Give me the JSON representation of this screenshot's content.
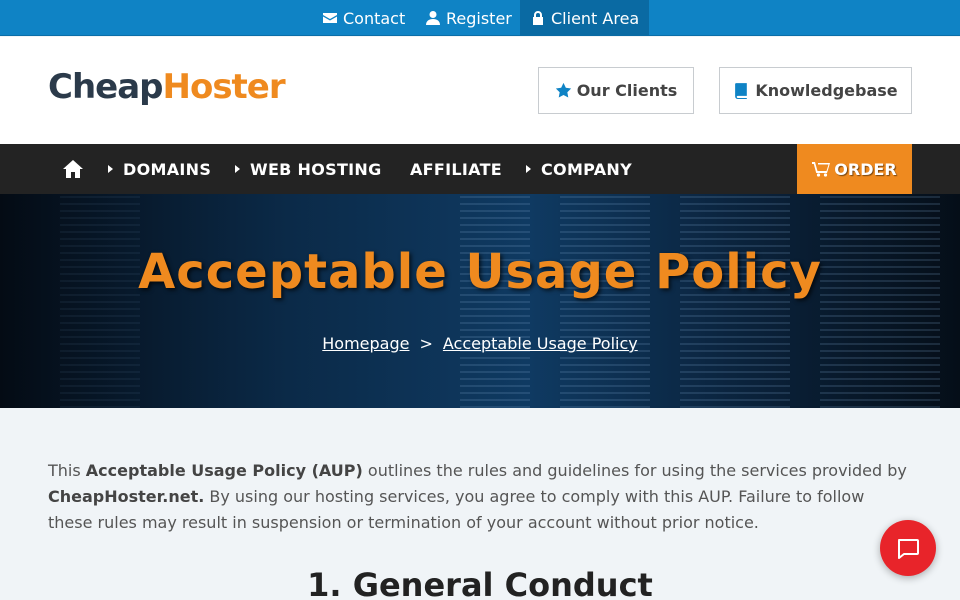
{
  "topbar": {
    "contact": "Contact",
    "register": "Register",
    "client_area": "Client Area"
  },
  "header": {
    "logo_part1": "Cheap",
    "logo_part2": "Hoster",
    "our_clients": "Our Clients",
    "knowledgebase": "Knowledgebase"
  },
  "nav": {
    "items": [
      "DOMAINS",
      "WEB HOSTING",
      "AFFILIATE",
      "COMPANY"
    ],
    "order": "ORDER"
  },
  "hero": {
    "title": "Acceptable Usage Policy",
    "breadcrumb_home": "Homepage",
    "breadcrumb_sep": ">",
    "breadcrumb_current": "Acceptable Usage Policy"
  },
  "content": {
    "intro_1": "This ",
    "intro_bold_1": "Acceptable Usage Policy (AUP)",
    "intro_2": " outlines the rules and guidelines for using the services provided by ",
    "intro_bold_2": "CheapHoster.net.",
    "intro_3": " By using our hosting services, you agree to comply with this AUP. Failure to follow these rules may result in suspension or termination of your account without prior notice.",
    "section_1_title": "1. General Conduct"
  },
  "colors": {
    "topbar": "#0f83c5",
    "accent_orange": "#ef8a1f",
    "nav_bg": "#232323",
    "chat_red": "#e8242a"
  }
}
